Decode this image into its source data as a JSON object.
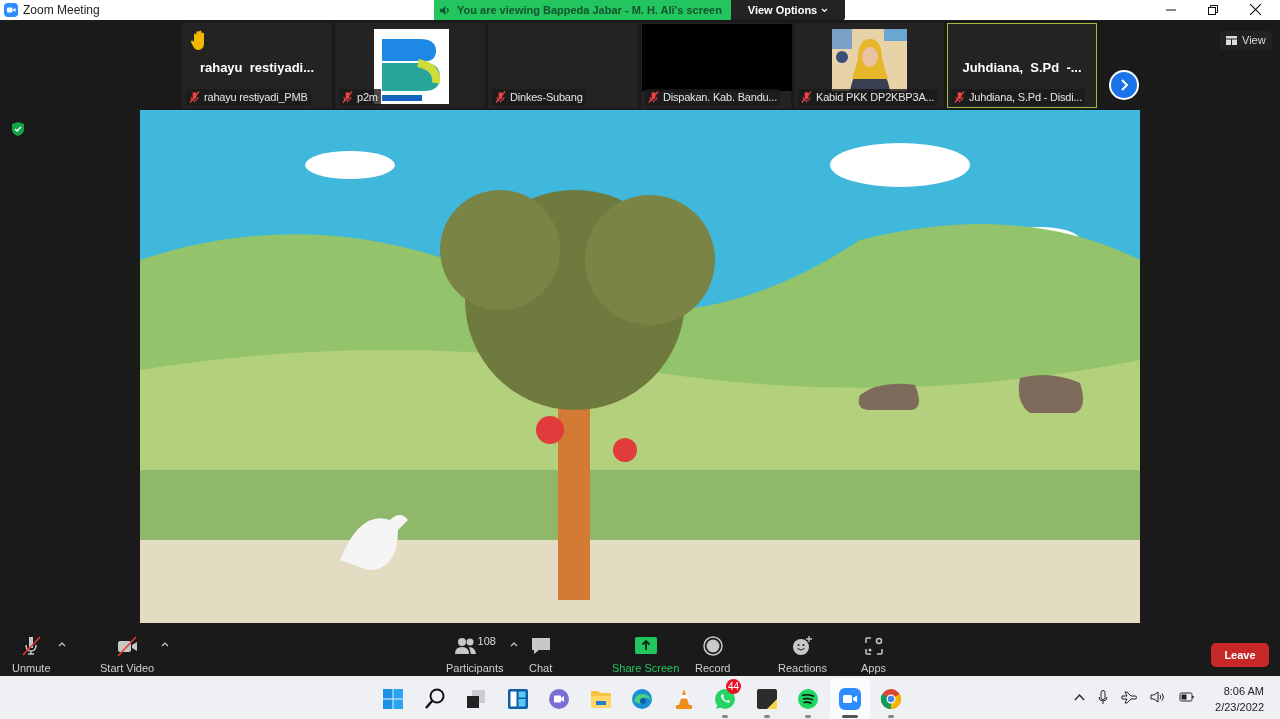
{
  "window": {
    "title": "Zoom Meeting"
  },
  "share_banner": {
    "text": "You are viewing Bappeda Jabar - M. H. Ali's screen",
    "options": "View Options"
  },
  "thumbnails": [
    {
      "kind": "name",
      "display_name": "rahayu  restiyadi...",
      "label": "rahayu restiyadi_PMB",
      "muted": true,
      "hand_raised": true,
      "active_speaker": false
    },
    {
      "kind": "logo",
      "label": "p2m",
      "muted": true,
      "hand_raised": false,
      "active_speaker": false
    },
    {
      "kind": "empty",
      "label": "Dinkes-Subang",
      "muted": true,
      "hand_raised": false,
      "active_speaker": false
    },
    {
      "kind": "black",
      "label": "Dispakan. Kab. Bandu...",
      "muted": true,
      "hand_raised": false,
      "active_speaker": false
    },
    {
      "kind": "camera",
      "label": "Kabid PKK DP2KBP3A...",
      "muted": true,
      "hand_raised": false,
      "active_speaker": false
    },
    {
      "kind": "name",
      "display_name": "Juhdiana,  S.Pd  -...",
      "label": "Juhdiana, S.Pd - Disdi...",
      "muted": true,
      "hand_raised": false,
      "active_speaker": true
    }
  ],
  "view_button": "View",
  "toolbar": [
    {
      "kind": "mic",
      "label": "Unmute",
      "off": true,
      "menu": true
    },
    {
      "kind": "video",
      "label": "Start Video",
      "off": true,
      "menu": true
    },
    {
      "kind": "participants",
      "label": "Participants",
      "count": "108",
      "menu": true
    },
    {
      "kind": "chat",
      "label": "Chat",
      "menu": false
    },
    {
      "kind": "share",
      "label": "Share Screen",
      "menu": false
    },
    {
      "kind": "record",
      "label": "Record",
      "menu": false
    },
    {
      "kind": "reactions",
      "label": "Reactions",
      "menu": false
    },
    {
      "kind": "apps",
      "label": "Apps",
      "menu": false
    }
  ],
  "leave_button": "Leave",
  "taskbar": [
    {
      "kind": "start",
      "running": false,
      "active": false
    },
    {
      "kind": "search",
      "running": false,
      "active": false
    },
    {
      "kind": "taskview",
      "running": false,
      "active": false
    },
    {
      "kind": "widgets",
      "running": false,
      "active": false
    },
    {
      "kind": "teams",
      "running": false,
      "active": false
    },
    {
      "kind": "files",
      "running": false,
      "active": false
    },
    {
      "kind": "edge",
      "running": false,
      "active": false
    },
    {
      "kind": "vlc",
      "running": false,
      "active": false
    },
    {
      "kind": "whatsapp",
      "running": true,
      "active": false,
      "badge": "44"
    },
    {
      "kind": "notes",
      "running": true,
      "active": false
    },
    {
      "kind": "spotify",
      "running": true,
      "active": false
    },
    {
      "kind": "zoom",
      "running": true,
      "active": true
    },
    {
      "kind": "chrome",
      "running": true,
      "active": false
    }
  ],
  "clock": {
    "time": "8:06 AM",
    "date": "2/23/2022"
  }
}
